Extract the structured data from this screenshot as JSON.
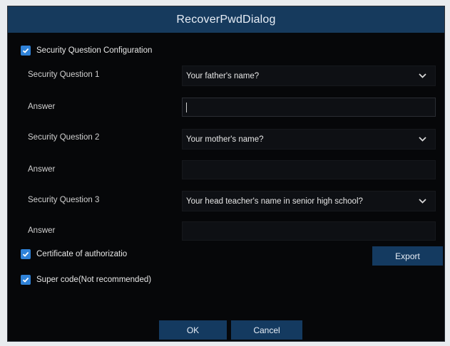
{
  "dialog": {
    "title": "RecoverPwdDialog",
    "security_config": {
      "label": "Security Question Configuration",
      "checked": true
    },
    "questions": [
      {
        "label": "Security Question 1",
        "selected": "Your father's name?",
        "answer_label": "Answer",
        "answer_value": ""
      },
      {
        "label": "Security Question 2",
        "selected": "Your mother's name?",
        "answer_label": "Answer",
        "answer_value": ""
      },
      {
        "label": "Security Question 3",
        "selected": "Your head teacher's name in senior high school?",
        "answer_label": "Answer",
        "answer_value": ""
      }
    ],
    "certificate": {
      "label": "Certificate of authorizatio",
      "checked": true
    },
    "export_label": "Export",
    "super_code": {
      "label": "Super code(Not recommended)",
      "checked": true
    },
    "ok_label": "OK",
    "cancel_label": "Cancel"
  },
  "colors": {
    "titlebar": "#163a5d",
    "checkbox": "#2f82d8",
    "button": "#143a60",
    "background": "#060709"
  },
  "icons": {
    "checkbox": "checkmark-icon",
    "dropdown": "chevron-down-icon"
  }
}
